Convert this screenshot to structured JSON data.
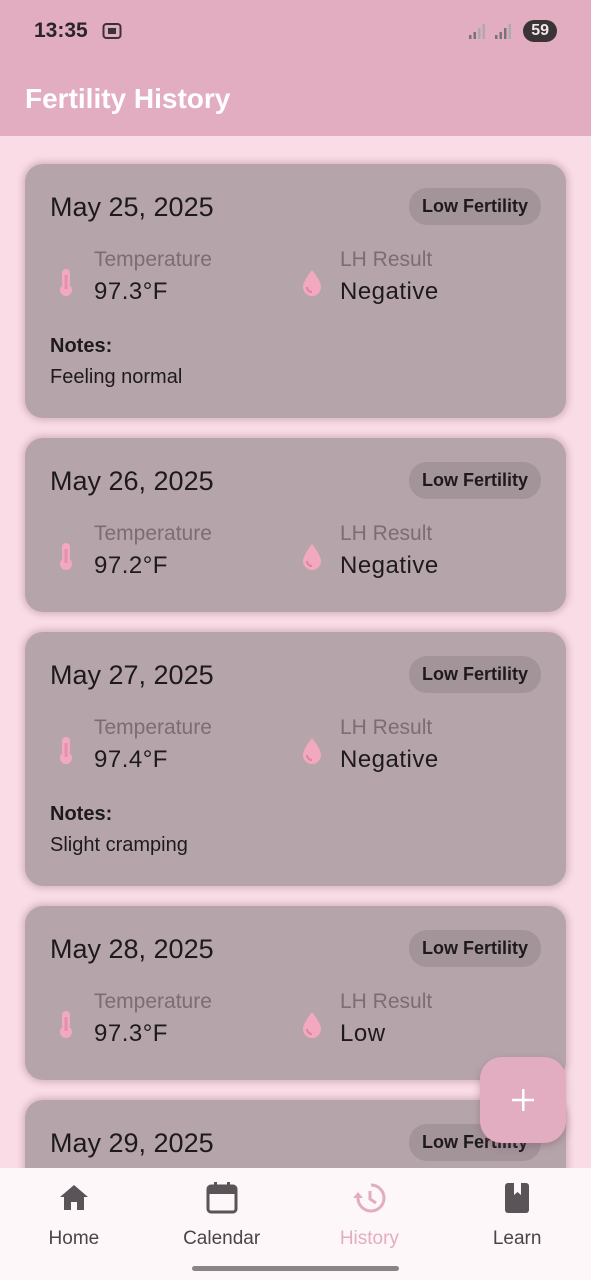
{
  "status_bar": {
    "time": "13:35",
    "battery": "59"
  },
  "app_bar": {
    "title": "Fertility History"
  },
  "labels": {
    "temperature": "Temperature",
    "lh_result": "LH Result",
    "notes": "Notes:"
  },
  "entries": [
    {
      "date": "May 25, 2025",
      "badge": "Low Fertility",
      "temperature": "97.3°F",
      "lh": "Negative",
      "notes": "Feeling normal"
    },
    {
      "date": "May 26, 2025",
      "badge": "Low Fertility",
      "temperature": "97.2°F",
      "lh": "Negative",
      "notes": ""
    },
    {
      "date": "May 27, 2025",
      "badge": "Low Fertility",
      "temperature": "97.4°F",
      "lh": "Negative",
      "notes": "Slight cramping"
    },
    {
      "date": "May 28, 2025",
      "badge": "Low Fertility",
      "temperature": "97.3°F",
      "lh": "Low",
      "notes": ""
    },
    {
      "date": "May 29, 2025",
      "badge": "Low Fertility"
    }
  ],
  "fab": {
    "icon": "plus-icon"
  },
  "nav": [
    {
      "label": "Home",
      "icon": "home-icon",
      "active": false
    },
    {
      "label": "Calendar",
      "icon": "calendar-icon",
      "active": false
    },
    {
      "label": "History",
      "icon": "history-icon",
      "active": true
    },
    {
      "label": "Learn",
      "icon": "book-icon",
      "active": false
    }
  ],
  "colors": {
    "primary": "#e2adc1",
    "background": "#f9dce6",
    "card": "#b5a5ab",
    "badge": "#a3949a",
    "icon_pink": "#f2a9c0",
    "nav_active": "#e2adc1"
  }
}
